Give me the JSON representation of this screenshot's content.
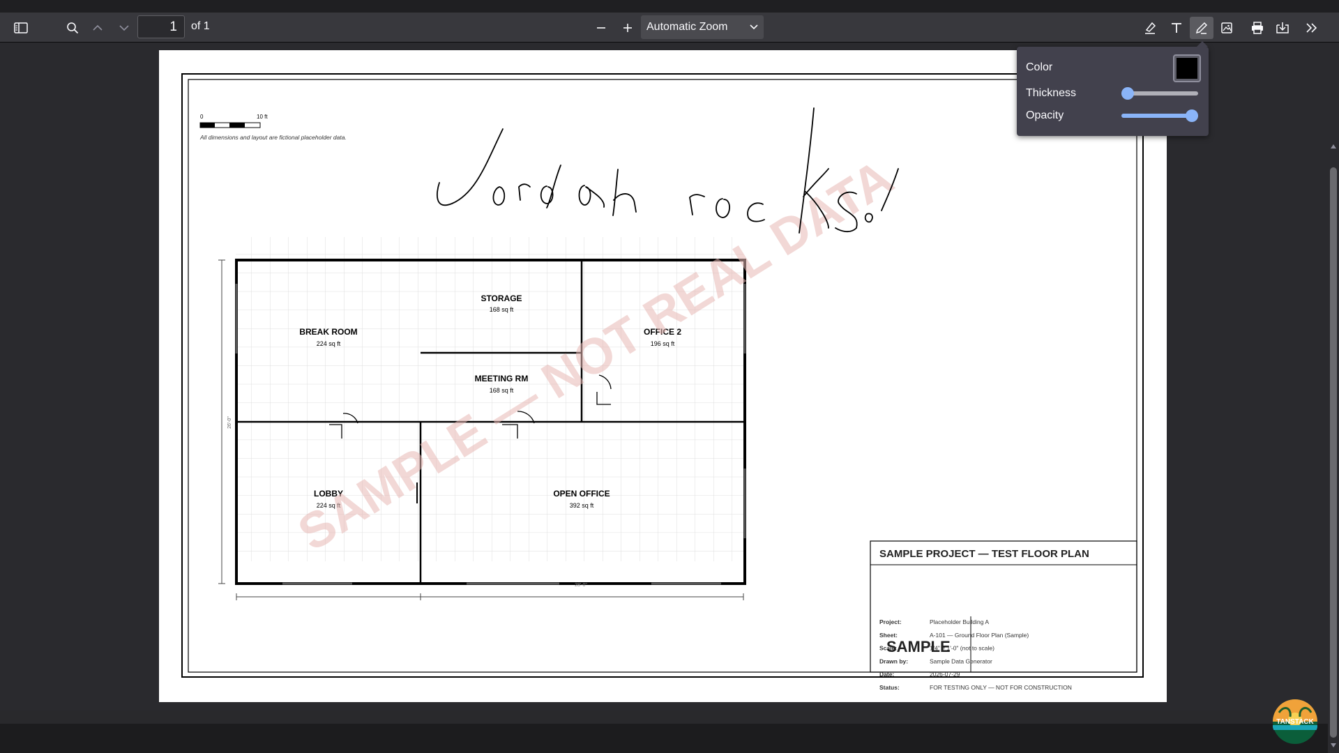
{
  "toolbar": {
    "page_number": "1",
    "page_count_label": "of 1",
    "zoom_label": "Automatic Zoom"
  },
  "draw_popover": {
    "color_label": "Color",
    "color_value": "#000000",
    "thickness_label": "Thickness",
    "thickness_level": 0.0,
    "opacity_label": "Opacity",
    "opacity_level": 1.0
  },
  "document": {
    "scale_bar": {
      "start": "0",
      "end": "10 ft"
    },
    "disclaimer": "All dimensions and layout are fictional placeholder data.",
    "handwriting_annotation": "Jordan rocks",
    "watermark": "SAMPLE — NOT REAL DATA",
    "rooms": [
      {
        "name": "STORAGE",
        "area": "168 sq ft"
      },
      {
        "name": "BREAK ROOM",
        "area": "224 sq ft"
      },
      {
        "name": "OFFICE 2",
        "area": "196 sq ft"
      },
      {
        "name": "MEETING RM",
        "area": "168 sq ft"
      },
      {
        "name": "LOBBY",
        "area": "224 sq ft"
      },
      {
        "name": "OPEN OFFICE",
        "area": "392 sq ft"
      }
    ],
    "dimension_vertical": "26'-0\"",
    "dimension_bottom": "28'-0\"",
    "title_block": {
      "title": "SAMPLE PROJECT — TEST FLOOR PLAN",
      "rows": [
        {
          "label": "Project:",
          "value": "Placeholder Building A"
        },
        {
          "label": "Sheet:",
          "value": "A-101  —  Ground Floor Plan (Sample)"
        },
        {
          "label": "Scale:",
          "value": "1/4\" = 1'-0\"  (not to scale)"
        },
        {
          "label": "Drawn by:",
          "value": "Sample Data Generator"
        },
        {
          "label": "Date:",
          "value": "2026-07-29"
        },
        {
          "label": "Status:",
          "value": "FOR TESTING ONLY — NOT FOR CONSTRUCTION"
        }
      ],
      "stamp": "SAMPLE"
    }
  },
  "logo": {
    "text": "TANSTACK"
  }
}
